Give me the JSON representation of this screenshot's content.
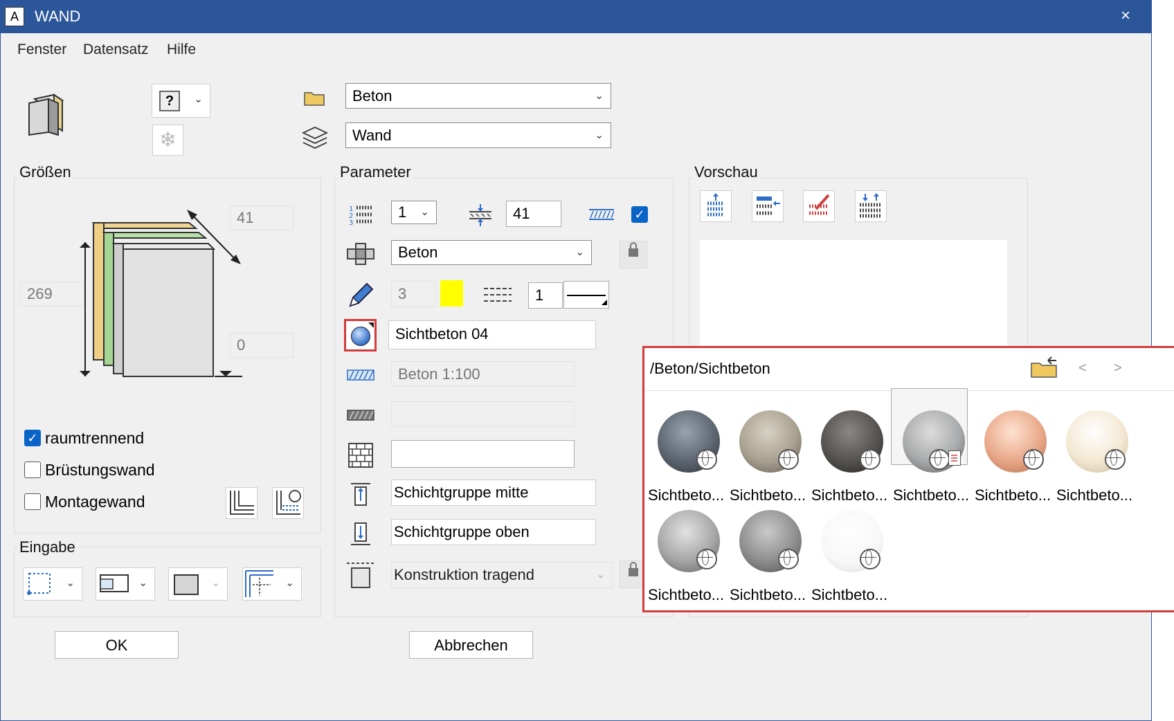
{
  "window": {
    "title": "WAND",
    "app_icon": "A",
    "close_glyph": "×"
  },
  "menu": [
    "Fenster",
    "Datensatz",
    "Hilfe"
  ],
  "top": {
    "help_glyph": "?",
    "folder_combo": "Beton",
    "layer_combo": "Wand"
  },
  "groessen": {
    "title": "Größen",
    "thickness": "41",
    "height": "269",
    "bottom": "0",
    "checkboxes": [
      {
        "label": "raumtrennend",
        "checked": true
      },
      {
        "label": "Brüstungswand",
        "checked": false
      },
      {
        "label": "Montagewand",
        "checked": false
      }
    ]
  },
  "eingabe": {
    "title": "Eingabe"
  },
  "parameter": {
    "title": "Parameter",
    "layer_count": "1",
    "thickness": "41",
    "flag_checked": true,
    "material": "Beton",
    "pen": "3",
    "color": "#ffff00",
    "line_thickness": "1",
    "surface": "Sichtbeton 04",
    "hatch": "Beton 1:100",
    "pattern": "",
    "fill": "",
    "group_mid": "Schichtgruppe mitte",
    "group_top": "Schichtgruppe oben",
    "construction": "Konstruktion tragend"
  },
  "vorschau": {
    "title": "Vorschau"
  },
  "popup": {
    "path": "/Beton/Sichtbeton",
    "prev": "<",
    "next": ">",
    "items": [
      {
        "label": "Sichtbeto...",
        "color": "#5d6670"
      },
      {
        "label": "Sichtbeto...",
        "color": "#a8a090"
      },
      {
        "label": "Sichtbeto...",
        "color": "#55524f"
      },
      {
        "label": "Sichtbeto...",
        "color": "#a9aaab",
        "selected": true
      },
      {
        "label": "Sichtbeto...",
        "color": "#e8a888"
      },
      {
        "label": "Sichtbeto...",
        "color": "#f3e8d2"
      },
      {
        "label": "Sichtbeto...",
        "color": "#a6a6a6"
      },
      {
        "label": "Sichtbeto...",
        "color": "#8e8e8e"
      },
      {
        "label": "Sichtbeto...",
        "color": "#f7f7f7"
      }
    ]
  },
  "buttons": {
    "ok": "OK",
    "cancel": "Abbrechen"
  }
}
